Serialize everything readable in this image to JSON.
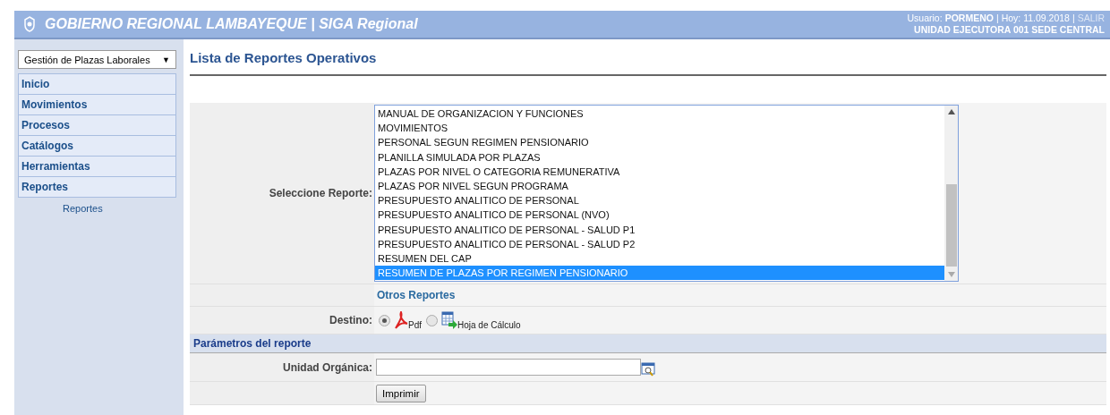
{
  "header": {
    "title": "GOBIERNO REGIONAL LAMBAYEQUE | SIGA Regional",
    "user_label": "Usuario:",
    "user": "PORMENO",
    "separator_1": "|",
    "date_label": "Hoy: 11.09.2018",
    "separator_2": "|",
    "logout": "SALIR",
    "unit": "UNIDAD EJECUTORA 001 SEDE CENTRAL"
  },
  "sidebar": {
    "module": "Gestión de Plazas Laborales",
    "module_arrow": "▼",
    "items": [
      {
        "label": "Inicio"
      },
      {
        "label": "Movimientos"
      },
      {
        "label": "Procesos"
      },
      {
        "label": "Catálogos"
      },
      {
        "label": "Herramientas"
      },
      {
        "label": "Reportes",
        "children": [
          {
            "label": "Reportes"
          }
        ]
      }
    ]
  },
  "page_title": "Lista de Reportes Operativos",
  "form": {
    "report_label": "Seleccione Reporte:",
    "reports": [
      {
        "label": "MANUAL DE ORGANIZACION Y FUNCIONES",
        "selected": false
      },
      {
        "label": "MOVIMIENTOS",
        "selected": false
      },
      {
        "label": "PERSONAL SEGUN REGIMEN PENSIONARIO",
        "selected": false
      },
      {
        "label": "PLANILLA SIMULADA POR PLAZAS",
        "selected": false
      },
      {
        "label": "PLAZAS POR NIVEL O CATEGORIA REMUNERATIVA",
        "selected": false
      },
      {
        "label": "PLAZAS POR NIVEL SEGUN PROGRAMA",
        "selected": false
      },
      {
        "label": "PRESUPUESTO ANALITICO DE PERSONAL",
        "selected": false
      },
      {
        "label": "PRESUPUESTO ANALITICO DE PERSONAL (NVO)",
        "selected": false
      },
      {
        "label": "PRESUPUESTO ANALITICO DE PERSONAL - SALUD P1",
        "selected": false
      },
      {
        "label": "PRESUPUESTO ANALITICO DE PERSONAL - SALUD P2",
        "selected": false
      },
      {
        "label": "RESUMEN DEL CAP",
        "selected": false
      },
      {
        "label": "RESUMEN DE PLAZAS POR REGIMEN PENSIONARIO",
        "selected": true
      }
    ],
    "other_reports": "Otros Reportes",
    "destination_label": "Destino:",
    "destinations": [
      {
        "kind": "pdf",
        "label": "Pdf",
        "selected": true
      },
      {
        "kind": "spreadsheet",
        "label": "Hoja de Cálculo",
        "selected": false
      }
    ],
    "params_heading": "Parámetros del reporte",
    "unit_label": "Unidad Orgánica:",
    "print_button": "Imprimir"
  }
}
